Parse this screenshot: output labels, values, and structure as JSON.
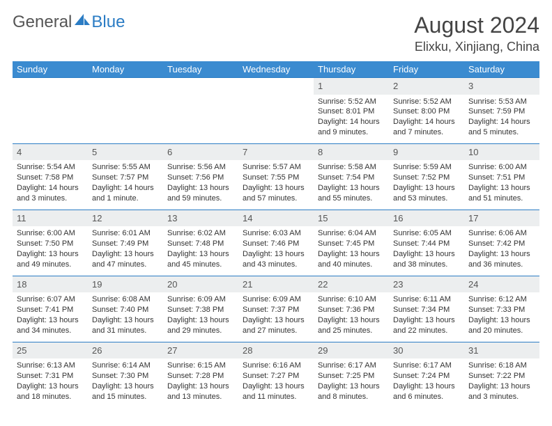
{
  "logo": {
    "general": "General",
    "blue": "Blue"
  },
  "title": "August 2024",
  "location": "Elixku, Xinjiang, China",
  "weekdays": [
    "Sunday",
    "Monday",
    "Tuesday",
    "Wednesday",
    "Thursday",
    "Friday",
    "Saturday"
  ],
  "weeks": [
    {
      "nums": [
        "",
        "",
        "",
        "",
        "1",
        "2",
        "3"
      ],
      "details": [
        "",
        "",
        "",
        "",
        "Sunrise: 5:52 AM\nSunset: 8:01 PM\nDaylight: 14 hours and 9 minutes.",
        "Sunrise: 5:52 AM\nSunset: 8:00 PM\nDaylight: 14 hours and 7 minutes.",
        "Sunrise: 5:53 AM\nSunset: 7:59 PM\nDaylight: 14 hours and 5 minutes."
      ]
    },
    {
      "nums": [
        "4",
        "5",
        "6",
        "7",
        "8",
        "9",
        "10"
      ],
      "details": [
        "Sunrise: 5:54 AM\nSunset: 7:58 PM\nDaylight: 14 hours and 3 minutes.",
        "Sunrise: 5:55 AM\nSunset: 7:57 PM\nDaylight: 14 hours and 1 minute.",
        "Sunrise: 5:56 AM\nSunset: 7:56 PM\nDaylight: 13 hours and 59 minutes.",
        "Sunrise: 5:57 AM\nSunset: 7:55 PM\nDaylight: 13 hours and 57 minutes.",
        "Sunrise: 5:58 AM\nSunset: 7:54 PM\nDaylight: 13 hours and 55 minutes.",
        "Sunrise: 5:59 AM\nSunset: 7:52 PM\nDaylight: 13 hours and 53 minutes.",
        "Sunrise: 6:00 AM\nSunset: 7:51 PM\nDaylight: 13 hours and 51 minutes."
      ]
    },
    {
      "nums": [
        "11",
        "12",
        "13",
        "14",
        "15",
        "16",
        "17"
      ],
      "details": [
        "Sunrise: 6:00 AM\nSunset: 7:50 PM\nDaylight: 13 hours and 49 minutes.",
        "Sunrise: 6:01 AM\nSunset: 7:49 PM\nDaylight: 13 hours and 47 minutes.",
        "Sunrise: 6:02 AM\nSunset: 7:48 PM\nDaylight: 13 hours and 45 minutes.",
        "Sunrise: 6:03 AM\nSunset: 7:46 PM\nDaylight: 13 hours and 43 minutes.",
        "Sunrise: 6:04 AM\nSunset: 7:45 PM\nDaylight: 13 hours and 40 minutes.",
        "Sunrise: 6:05 AM\nSunset: 7:44 PM\nDaylight: 13 hours and 38 minutes.",
        "Sunrise: 6:06 AM\nSunset: 7:42 PM\nDaylight: 13 hours and 36 minutes."
      ]
    },
    {
      "nums": [
        "18",
        "19",
        "20",
        "21",
        "22",
        "23",
        "24"
      ],
      "details": [
        "Sunrise: 6:07 AM\nSunset: 7:41 PM\nDaylight: 13 hours and 34 minutes.",
        "Sunrise: 6:08 AM\nSunset: 7:40 PM\nDaylight: 13 hours and 31 minutes.",
        "Sunrise: 6:09 AM\nSunset: 7:38 PM\nDaylight: 13 hours and 29 minutes.",
        "Sunrise: 6:09 AM\nSunset: 7:37 PM\nDaylight: 13 hours and 27 minutes.",
        "Sunrise: 6:10 AM\nSunset: 7:36 PM\nDaylight: 13 hours and 25 minutes.",
        "Sunrise: 6:11 AM\nSunset: 7:34 PM\nDaylight: 13 hours and 22 minutes.",
        "Sunrise: 6:12 AM\nSunset: 7:33 PM\nDaylight: 13 hours and 20 minutes."
      ]
    },
    {
      "nums": [
        "25",
        "26",
        "27",
        "28",
        "29",
        "30",
        "31"
      ],
      "details": [
        "Sunrise: 6:13 AM\nSunset: 7:31 PM\nDaylight: 13 hours and 18 minutes.",
        "Sunrise: 6:14 AM\nSunset: 7:30 PM\nDaylight: 13 hours and 15 minutes.",
        "Sunrise: 6:15 AM\nSunset: 7:28 PM\nDaylight: 13 hours and 13 minutes.",
        "Sunrise: 6:16 AM\nSunset: 7:27 PM\nDaylight: 13 hours and 11 minutes.",
        "Sunrise: 6:17 AM\nSunset: 7:25 PM\nDaylight: 13 hours and 8 minutes.",
        "Sunrise: 6:17 AM\nSunset: 7:24 PM\nDaylight: 13 hours and 6 minutes.",
        "Sunrise: 6:18 AM\nSunset: 7:22 PM\nDaylight: 13 hours and 3 minutes."
      ]
    }
  ]
}
